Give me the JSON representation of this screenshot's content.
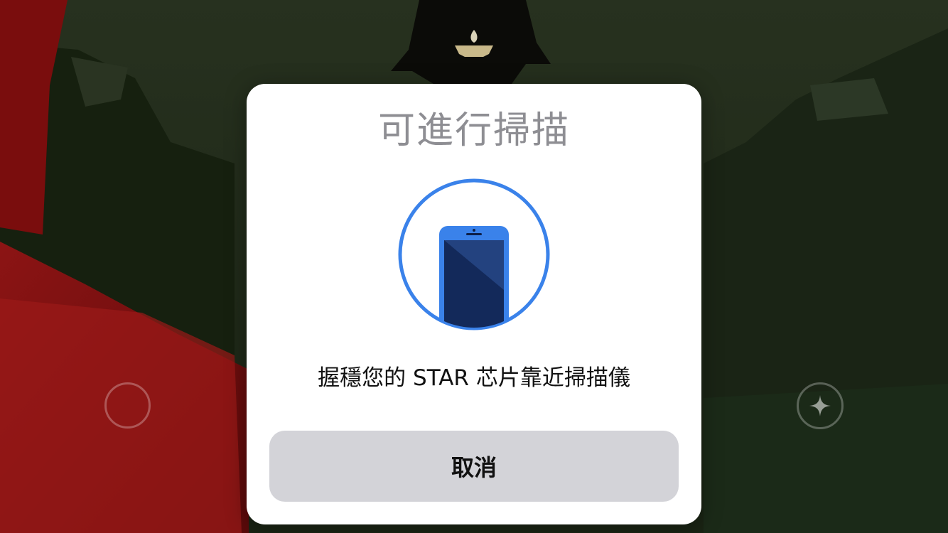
{
  "dialog": {
    "title": "可進行掃描",
    "message": "握穩您的 STAR 芯片靠近掃描儀",
    "cancel_label": "取消",
    "illustration_icon": "phone-icon"
  },
  "hud": {
    "left_control_icon": "joystick-ring-icon",
    "right_control_icon": "sparkle-star-icon"
  },
  "colors": {
    "accent": "#3a82ea",
    "phone_screen": "#1b3266",
    "title_gray": "#8e8e93",
    "button_bg": "#d3d3d8"
  }
}
